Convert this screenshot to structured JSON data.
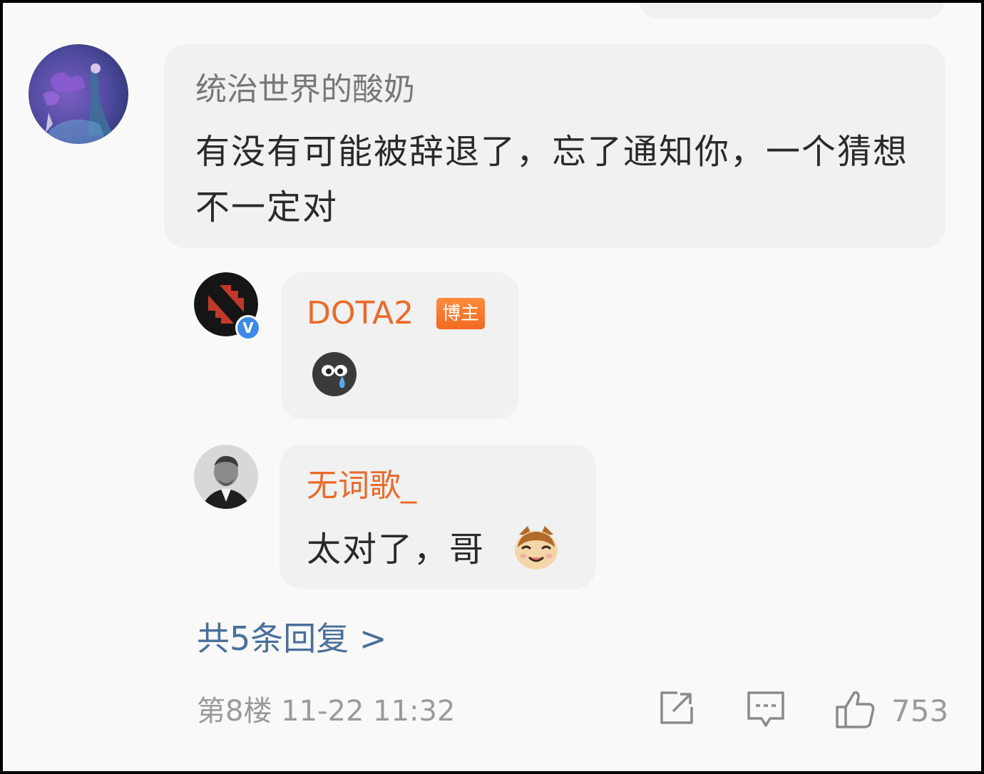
{
  "comment": {
    "username": "统治世界的酸奶",
    "text": "有没有可能被辞退了，忘了通知你，一个猜想 不一定对",
    "floor": "第8楼",
    "timestamp": "11-22 11:32",
    "like_count": "753"
  },
  "replies": [
    {
      "username": "DOTA2",
      "badge": "博主",
      "verified_mark": "V",
      "emoji": "crying-face-icon"
    },
    {
      "username": "无词歌_",
      "text": "太对了，哥",
      "emoji": "cat-face-icon"
    }
  ],
  "more_replies_label": "共5条回复 >",
  "colors": {
    "background": "#f9f9f9",
    "bubble": "#f1f1f1",
    "username_orange": "#ea6a2a",
    "link_blue": "#4a6f9a",
    "meta_gray": "#9a9a9a"
  }
}
